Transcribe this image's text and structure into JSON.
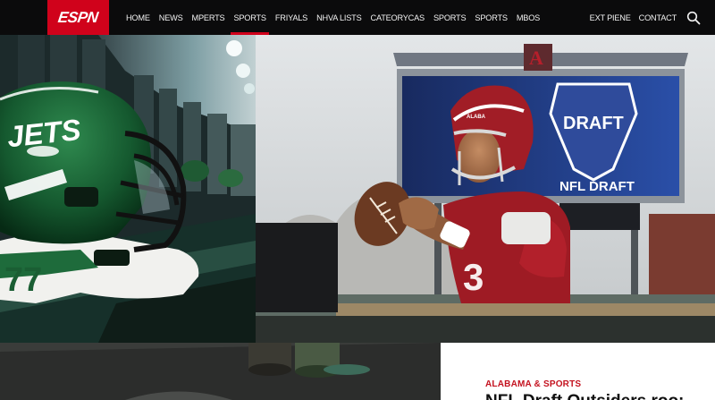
{
  "brand": {
    "logo": "ESPN",
    "accent": "#d0021b"
  },
  "nav": {
    "items": [
      {
        "label": "HOME",
        "active": false
      },
      {
        "label": "NEWS",
        "active": false
      },
      {
        "label": "MPERTS",
        "active": false
      },
      {
        "label": "SPORTS",
        "active": true
      },
      {
        "label": "FRIYALS",
        "active": false
      },
      {
        "label": "NHVA LISTS",
        "active": false
      },
      {
        "label": "CATEORYCAS",
        "active": false
      },
      {
        "label": "SPORTS",
        "active": false
      },
      {
        "label": "SPORTS",
        "active": false
      },
      {
        "label": "MBOS",
        "active": false
      }
    ],
    "right_items": [
      {
        "label": "EXT PIENE"
      },
      {
        "label": "CONTACT"
      }
    ],
    "search_icon": "search-icon"
  },
  "hero": {
    "helmet_logo": "JETS",
    "jersey_number": "77",
    "scoreboard_text": "DRAFT",
    "scoreboard_sub": "NFL DRAFT",
    "player_helmet_text": "ALABA"
  },
  "article": {
    "kicker": "ALABAMA & SPORTS",
    "headline": "NFL Draft Outsiders roo:"
  }
}
